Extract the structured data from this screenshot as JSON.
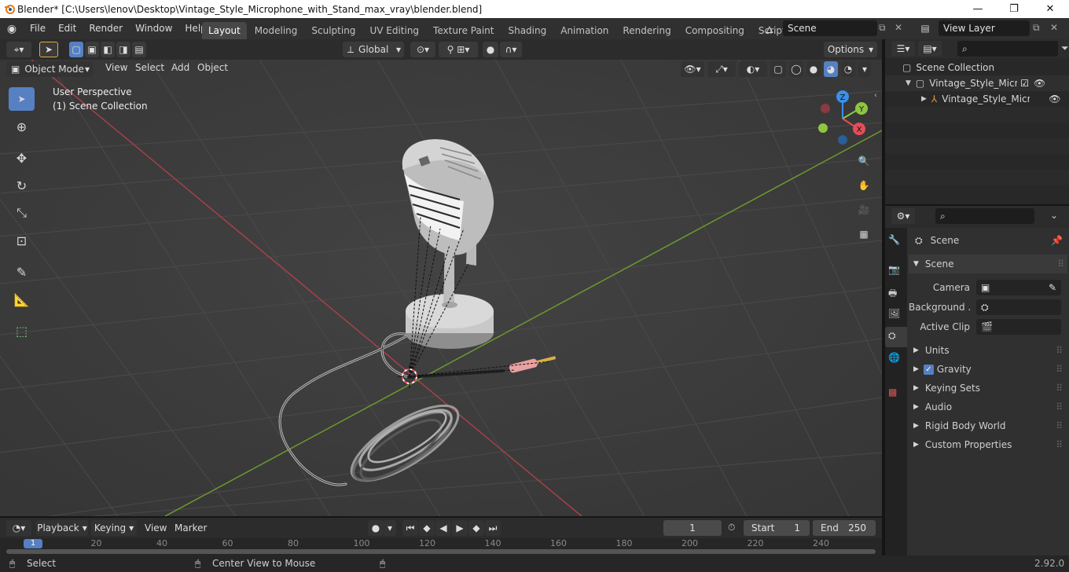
{
  "window": {
    "title": "Blender* [C:\\Users\\lenov\\Desktop\\Vintage_Style_Microphone_with_Stand_max_vray\\blender.blend]",
    "minimize": "—",
    "maximize": "❐",
    "close": "✕"
  },
  "menu": [
    "File",
    "Edit",
    "Render",
    "Window",
    "Help"
  ],
  "workspaces": [
    "Layout",
    "Modeling",
    "Sculpting",
    "UV Editing",
    "Texture Paint",
    "Shading",
    "Animation",
    "Rendering",
    "Compositing",
    "Scripting"
  ],
  "active_workspace": "Layout",
  "scene_field": "Scene",
  "view_layer_field": "View Layer",
  "viewport_header": {
    "mode": "Object Mode",
    "menus": [
      "View",
      "Select",
      "Add",
      "Object"
    ],
    "transform_orientation": "Global",
    "options": "Options"
  },
  "viewport": {
    "perspective_label": "User Perspective",
    "collection_label": "(1) Scene Collection",
    "gizmo_axes": [
      "Z",
      "Y",
      "X"
    ]
  },
  "outliner": {
    "root": "Scene Collection",
    "items": [
      "Vintage_Style_Micropho",
      "Vintage_Style_Micro"
    ]
  },
  "properties": {
    "context": "Scene",
    "panel": "Scene",
    "camera_label": "Camera",
    "background_label": "Background ...",
    "active_clip_label": "Active Clip",
    "sections": [
      "Units",
      "Gravity",
      "Keying Sets",
      "Audio",
      "Rigid Body World",
      "Custom Properties"
    ]
  },
  "timeline": {
    "menus": [
      "Playback",
      "Keying",
      "View",
      "Marker"
    ],
    "current_frame": "1",
    "start_label": "Start",
    "start": "1",
    "end_label": "End",
    "end": "250",
    "ruler": [
      "1",
      "20",
      "40",
      "60",
      "80",
      "100",
      "120",
      "140",
      "160",
      "180",
      "200",
      "220",
      "240"
    ]
  },
  "status": {
    "select": "Select",
    "center_view": "Center View to Mouse",
    "version": "2.92.0"
  },
  "colors": {
    "accent": "#5680c2",
    "axis_x": "#e44d5a",
    "axis_y": "#8dc63f",
    "axis_z": "#3b8fe8"
  }
}
